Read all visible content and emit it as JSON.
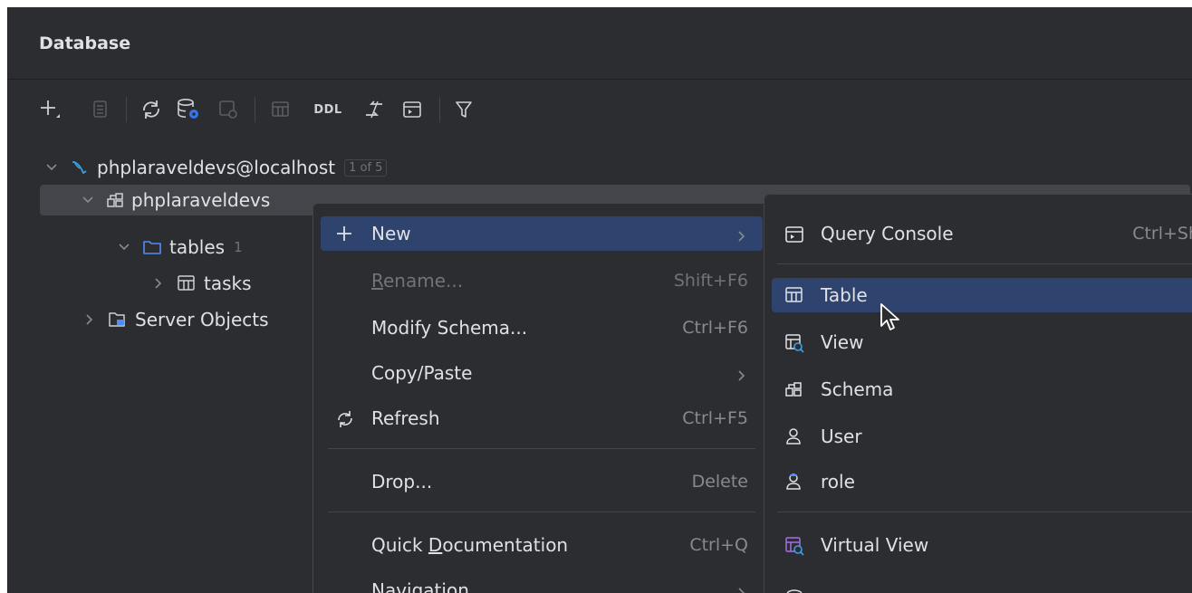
{
  "panel": {
    "title": "Database"
  },
  "toolbar": {
    "ddl_label": "DDL"
  },
  "tree": {
    "connection": {
      "label": "phplaraveldevs@localhost",
      "badge": "1 of 5"
    },
    "schema": {
      "label": "phplaraveldevs"
    },
    "tables": {
      "label": "tables",
      "count": "1"
    },
    "tasks": {
      "label": "tasks"
    },
    "server_objects": {
      "label": "Server Objects"
    }
  },
  "context_menu": {
    "items": [
      {
        "label": "New",
        "shortcut": ""
      },
      {
        "label_underlined": "R",
        "label_rest": "ename...",
        "shortcut": "Shift+F6"
      },
      {
        "label": "Modify Schema...",
        "shortcut": "Ctrl+F6"
      },
      {
        "label": "Copy/Paste",
        "shortcut": ""
      },
      {
        "label": "Refresh",
        "shortcut": "Ctrl+F5"
      },
      {
        "label": "Drop...",
        "shortcut": "Delete"
      },
      {
        "label_prefix": "Quick ",
        "label_underlined": "D",
        "label_rest": "ocumentation",
        "shortcut": "Ctrl+Q"
      },
      {
        "label": "Navigation",
        "shortcut": ""
      }
    ]
  },
  "submenu": {
    "items": [
      {
        "label": "Query Console",
        "shortcut": "Ctrl+Shift+Q"
      },
      {
        "label": "Table"
      },
      {
        "label": "View"
      },
      {
        "label": "Schema"
      },
      {
        "label": "User"
      },
      {
        "label": "role"
      },
      {
        "label": "Virtual View"
      }
    ]
  },
  "colors": {
    "panel_bg": "#2b2d30",
    "selection": "#2e436e",
    "tree_selection": "#43454a",
    "text": "#dfe1e5",
    "muted": "#868a91",
    "connection_icon": "#3d9ee6",
    "folder_icon": "#548af7",
    "virtual_view_icon": "#a571e6"
  }
}
